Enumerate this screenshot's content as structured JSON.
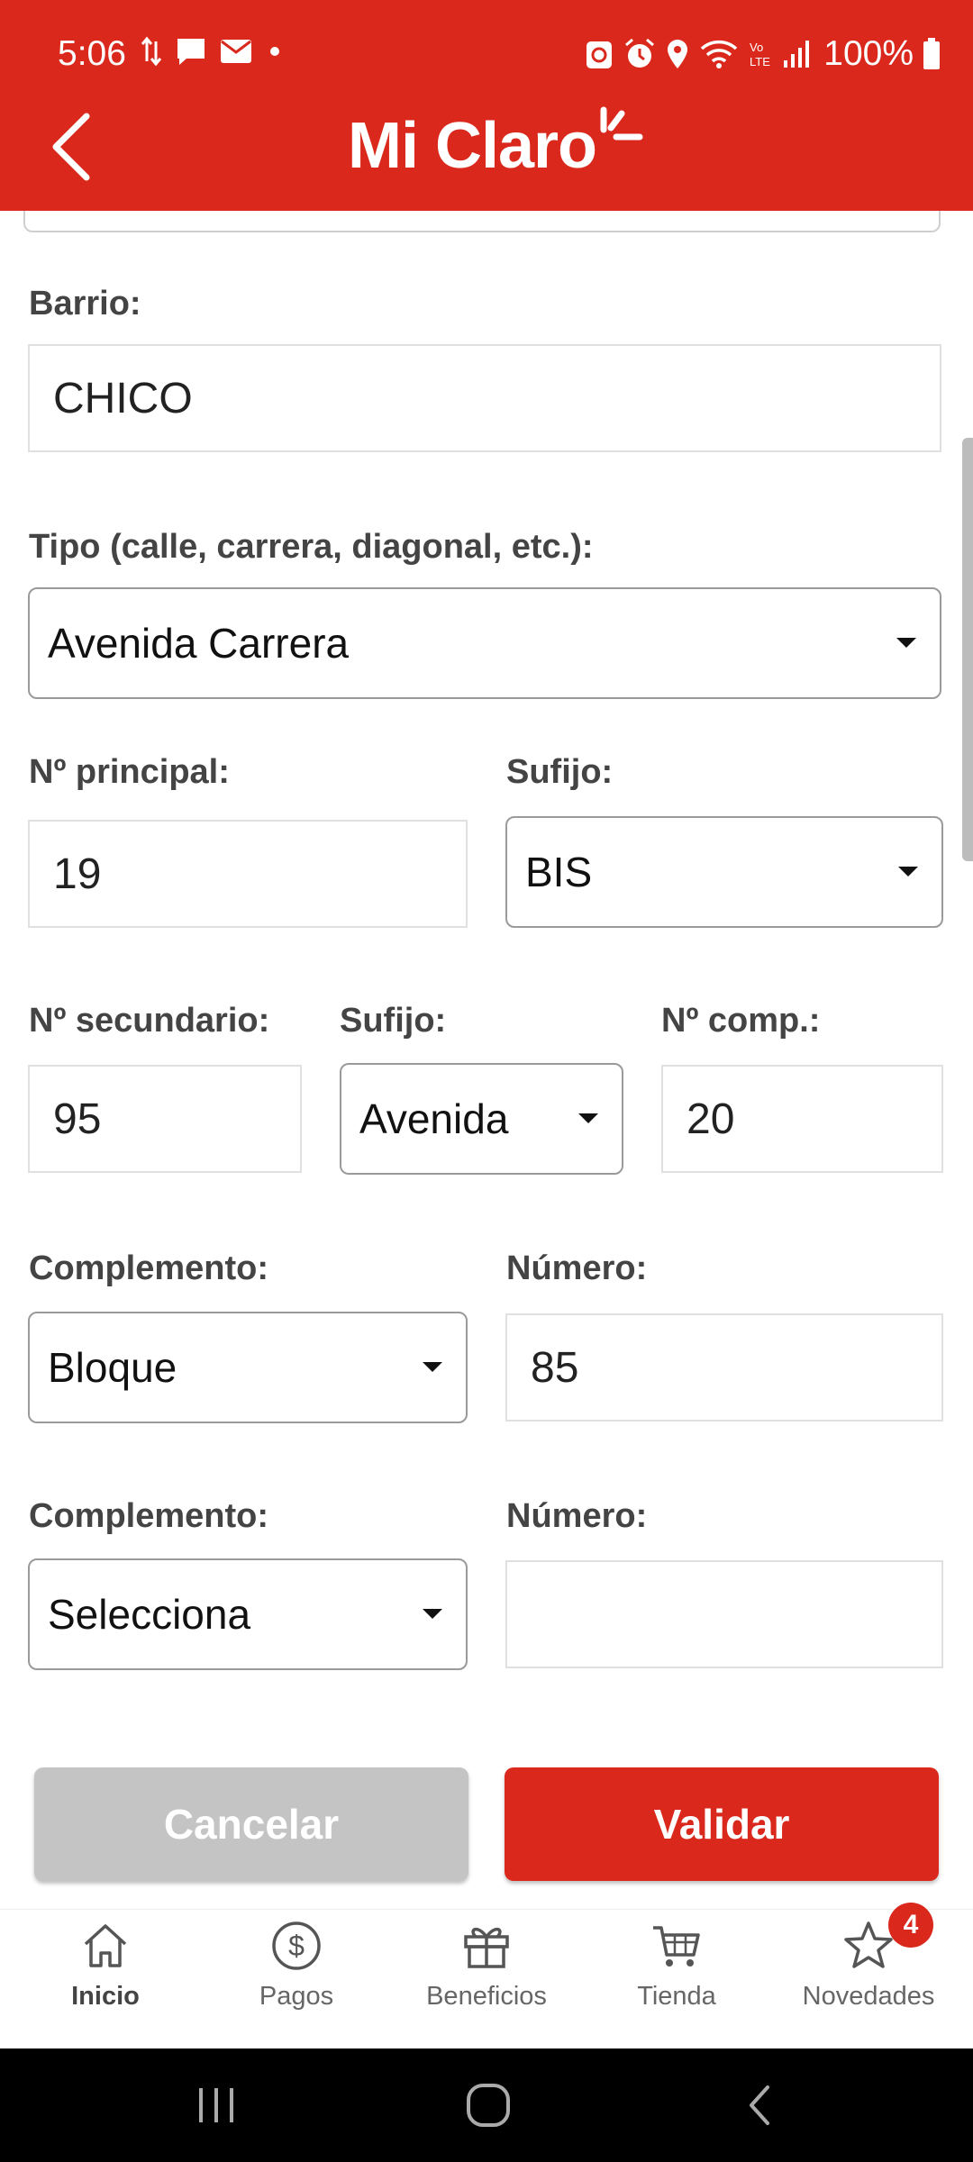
{
  "status_bar": {
    "time": "5:06",
    "battery": "100%"
  },
  "header": {
    "logo_text": "Mi Claro",
    "brand_color": "#da291c"
  },
  "form": {
    "barrio": {
      "label": "Barrio:",
      "value": "CHICO"
    },
    "tipo": {
      "label": "Tipo (calle, carrera, diagonal, etc.):",
      "value": "Avenida Carrera"
    },
    "numero_principal": {
      "label": "Nº principal:",
      "value": "19"
    },
    "sufijo_1": {
      "label": "Sufijo:",
      "value": "BIS"
    },
    "numero_secundario": {
      "label": "Nº secundario:",
      "value": "95"
    },
    "sufijo_2": {
      "label": "Sufijo:",
      "value": "Avenida"
    },
    "numero_comp": {
      "label": "Nº comp.:",
      "value": "20"
    },
    "complemento_1": {
      "label": "Complemento:",
      "value": "Bloque"
    },
    "numero_1": {
      "label": "Número:",
      "value": "85"
    },
    "complemento_2": {
      "label": "Complemento:",
      "value": "Selecciona"
    },
    "numero_2": {
      "label": "Número:",
      "value": ""
    }
  },
  "actions": {
    "cancel_label": "Cancelar",
    "validate_label": "Validar",
    "cancel_color": "#c4c4c4",
    "validate_color": "#da291c"
  },
  "bottom_nav": {
    "items": [
      {
        "label": "Inicio",
        "icon": "home-icon",
        "active": true
      },
      {
        "label": "Pagos",
        "icon": "dollar-coin-icon"
      },
      {
        "label": "Beneficios",
        "icon": "gift-icon"
      },
      {
        "label": "Tienda",
        "icon": "cart-icon"
      },
      {
        "label": "Novedades",
        "icon": "star-icon",
        "badge": "4"
      }
    ]
  }
}
